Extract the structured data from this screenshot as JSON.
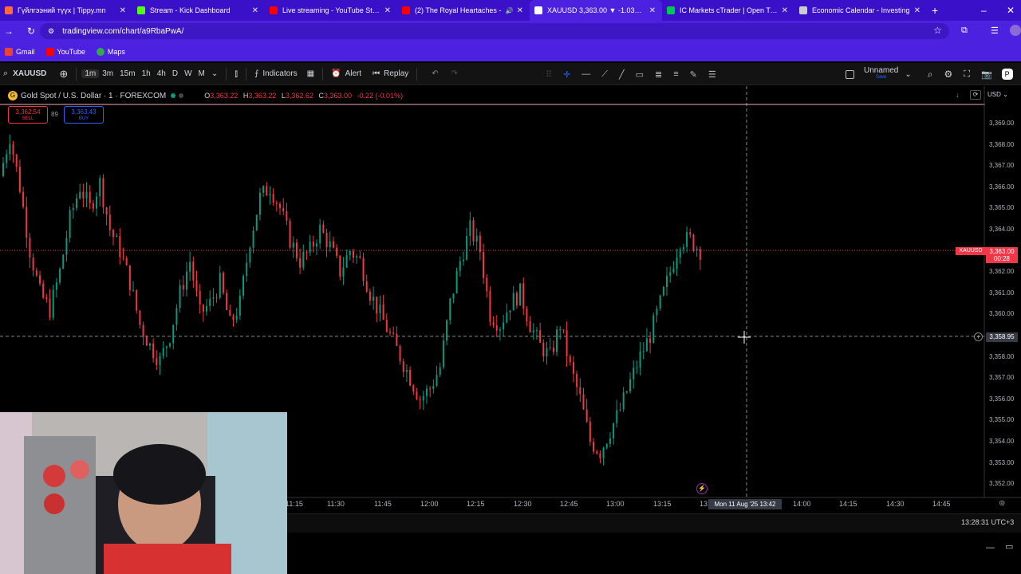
{
  "browser": {
    "tabs": [
      {
        "title": "Гүйлгээний түүх | Tippy.mn",
        "icon_color": "#ff6a3d"
      },
      {
        "title": "Stream - Kick Dashboard",
        "icon_color": "#53fc18"
      },
      {
        "title": "Live streaming - YouTube Studio",
        "icon_color": "#ff0000"
      },
      {
        "title": "(2) The Royal Heartaches -",
        "icon_color": "#ff0000"
      },
      {
        "title": "XAUUSD 3,363.00 ▼ -1.03% Un",
        "icon_color": "#ffffff"
      },
      {
        "title": "IC Markets cTrader | Open Trad",
        "icon_color": "#00c853"
      },
      {
        "title": "Economic Calendar - Investing",
        "icon_color": "#cccccc"
      }
    ],
    "url": "tradingview.com/chart/a9RbaPwA/",
    "bookmarks": [
      "Gmail",
      "YouTube",
      "Maps"
    ]
  },
  "toolbar": {
    "symbol": "XAUUSD",
    "timeframes": [
      "1m",
      "3m",
      "15m",
      "1h",
      "4h",
      "D",
      "W",
      "M"
    ],
    "selected_timeframe": "1m",
    "indicators_label": "Indicators",
    "alert_label": "Alert",
    "replay_label": "Replay",
    "layout_name": "Unnamed",
    "layout_sub": "Save"
  },
  "legend": {
    "title": "Gold Spot / U.S. Dollar · 1 · FOREXCOM",
    "open_label": "O",
    "open": "3,363.22",
    "high_label": "H",
    "high": "3,363.22",
    "low_label": "L",
    "low": "3,362.62",
    "close_label": "C",
    "close": "3,363.00",
    "change": "-0.22 (-0.01%)",
    "sell_price": "3,362.54",
    "sell_label": "SELL",
    "spread": "89",
    "buy_price": "3,363.43",
    "buy_label": "BUY"
  },
  "currency": "USD",
  "price_axis": [
    "3,369.00",
    "3,368.00",
    "3,367.00",
    "3,366.00",
    "3,365.00",
    "3,364.00",
    "3,363.00",
    "3,362.00",
    "3,361.00",
    "3,360.00",
    "3,359.00",
    "3,358.00",
    "3,357.00",
    "3,356.00",
    "3,355.00",
    "3,354.00",
    "3,353.00",
    "3,352.00"
  ],
  "time_axis": [
    "11:15",
    "11:30",
    "11:45",
    "12:00",
    "12:15",
    "12:30",
    "12:45",
    "13:00",
    "13:15",
    "13:30",
    "14:00",
    "14:15",
    "14:30",
    "14:45"
  ],
  "last_price": {
    "symbol": "XAUUSD",
    "price": "3,363.00",
    "countdown": "00:28"
  },
  "crosshair": {
    "price": "3,358.95",
    "time": "Mon 11 Aug '25  13:42"
  },
  "clock": "13:28:31 UTC+3",
  "colors": {
    "up": "#089981",
    "down": "#f23645",
    "browser_bg": "#4c22e0"
  },
  "chart_data": {
    "type": "candlestick",
    "title": "Gold Spot / U.S. Dollar · 1 · FOREXCOM",
    "ylim": [
      3351.5,
      3369.5
    ],
    "x": [
      "11:15",
      "11:30",
      "11:45",
      "12:00",
      "12:15",
      "12:30",
      "12:45",
      "13:00",
      "13:15",
      "13:28"
    ],
    "path": [
      3366.5,
      3368.4,
      3366.0,
      3363.0,
      3361.0,
      3360.2,
      3362.0,
      3364.5,
      3366.0,
      3365.0,
      3366.2,
      3364.0,
      3363.0,
      3361.5,
      3359.5,
      3358.5,
      3357.8,
      3359.0,
      3361.0,
      3362.5,
      3360.0,
      3360.5,
      3361.5,
      3359.5,
      3360.5,
      3363.5,
      3365.5,
      3366.0,
      3365.0,
      3363.5,
      3362.5,
      3363.0,
      3364.0,
      3363.2,
      3362.0,
      3363.0,
      3362.5,
      3361.0,
      3360.0,
      3359.0,
      3358.0,
      3357.0,
      3356.0,
      3356.5,
      3357.5,
      3360.5,
      3362.5,
      3364.0,
      3363.0,
      3360.0,
      3359.5,
      3360.5,
      3361.0,
      3359.5,
      3358.5,
      3358.0,
      3359.5,
      3357.5,
      3356.0,
      3354.0,
      3353.5,
      3354.5,
      3355.5,
      3356.8,
      3358.0,
      3359.0,
      3360.5,
      3362.0,
      3363.5,
      3363.5,
      3363.0
    ]
  }
}
